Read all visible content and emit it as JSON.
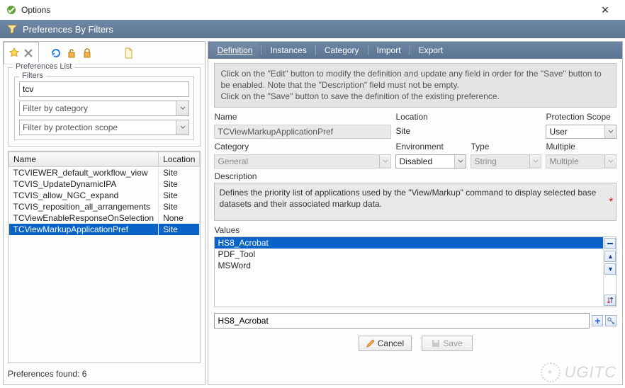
{
  "window": {
    "title": "Options"
  },
  "subheader": {
    "title": "Preferences By Filters"
  },
  "left": {
    "prefs_legend": "Preferences List",
    "filters_legend": "Filters",
    "filter_value": "tcv",
    "filter_category_placeholder": "Filter by category",
    "filter_scope_placeholder": "Filter by protection scope",
    "cols": {
      "name": "Name",
      "location": "Location"
    },
    "rows": [
      {
        "name": "TCVIEWER_default_workflow_view",
        "loc": "Site"
      },
      {
        "name": "TCVIS_UpdateDynamicIPA",
        "loc": "Site"
      },
      {
        "name": "TCVIS_allow_NGC_expand",
        "loc": "Site"
      },
      {
        "name": "TCVIS_reposition_all_arrangements",
        "loc": "Site"
      },
      {
        "name": "TCViewEnableResponseOnSelection",
        "loc": "None"
      },
      {
        "name": "TCViewMarkupApplicationPref",
        "loc": "Site"
      }
    ],
    "selected_index": 5,
    "footer": "Preferences found: 6"
  },
  "right": {
    "tabs": [
      "Definition",
      "Instances",
      "Category",
      "Import",
      "Export"
    ],
    "active_tab": 0,
    "hint_lines": [
      "Click on the \"Edit\" button to modify the definition and update any field in order for the \"Save\" button to be enabled. Note that the \"Description\" field must not be empty.",
      "Click on the \"Save\" button to save the definition of the existing preference."
    ],
    "fields": {
      "name_lbl": "Name",
      "name_val": "TCViewMarkupApplicationPref",
      "location_lbl": "Location",
      "location_val": "Site",
      "scope_lbl": "Protection Scope",
      "scope_val": "User",
      "category_lbl": "Category",
      "category_val": "General",
      "env_lbl": "Environment",
      "env_val": "Disabled",
      "type_lbl": "Type",
      "type_val": "String",
      "multi_lbl": "Multiple",
      "multi_val": "Multiple",
      "desc_lbl": "Description",
      "desc_val": "Defines the priority list of applications used by the \"View/Markup\" command to display selected base datasets and their associated markup data.",
      "values_lbl": "Values"
    },
    "values": [
      "HS8_Acrobat",
      "PDF_Tool",
      "MSWord"
    ],
    "values_selected": 0,
    "value_input": "HS8_Acrobat",
    "buttons": {
      "cancel": "Cancel",
      "save": "Save"
    }
  },
  "watermark": "UGITC"
}
